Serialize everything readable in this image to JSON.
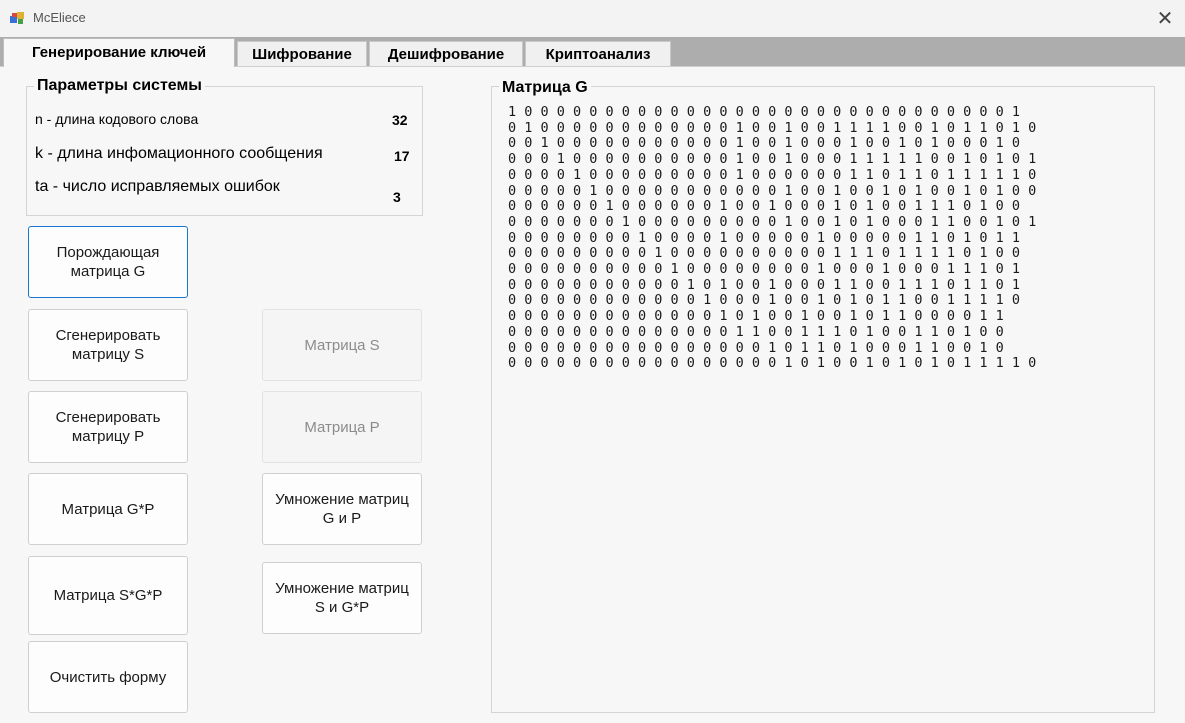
{
  "window": {
    "title": "McEliece",
    "close_glyph": "✕"
  },
  "tabs": [
    {
      "label": "Генерирование ключей",
      "active": true
    },
    {
      "label": "Шифрование",
      "active": false
    },
    {
      "label": "Дешифрование",
      "active": false
    },
    {
      "label": "Криптоанализ",
      "active": false
    }
  ],
  "params": {
    "title": "Параметры системы",
    "n_label": "n - длина кодового слова",
    "n_value": "32",
    "k_label": "k - длина инфомационного сообщения",
    "k_value": "17",
    "t_label": "ta - число исправляемых ошибок",
    "t_value": "3"
  },
  "buttons": {
    "generator_g": "Порождающая матрица G",
    "generate_s": "Сгенерировать матрицу S",
    "generate_p": "Сгенерировать матрицу P",
    "matrix_gp": "Матрица G*P",
    "matrix_sgp": "Матрица S*G*P",
    "clear_form": "Очистить форму",
    "matrix_s": "Матрица S",
    "matrix_p": "Матрица P",
    "multiply_gp": "Умножение матриц G и P",
    "multiply_sgp": "Умножение матриц S и G*P"
  },
  "matrix_g": {
    "title": "Матрица G",
    "rows": [
      "1 0 0 0 0 0 0 0 0 0 0 0 0 0 0 0 0 0 0 0 0 0 0 0 0 0 0 0 0 0 0 1",
      "0 1 0 0 0 0 0 0 0 0 0 0 0 0 1 0 0 1 0 0 1 1 1 1 0 0 1 0 1 1 0 1 0",
      "0 0 1 0 0 0 0 0 0 0 0 0 0 0 1 0 0 1 0 0 0 1 0 0 1 0 1 0 0 0 1 0",
      "0 0 0 1 0 0 0 0 0 0 0 0 0 0 1 0 0 1 0 0 0 1 1 1 1 1 0 0 1 0 1 0 1",
      "0 0 0 0 1 0 0 0 0 0 0 0 0 0 1 0 0 0 0 0 0 1 1 0 1 1 0 1 1 1 1 1 0",
      "0 0 0 0 0 1 0 0 0 0 0 0 0 0 0 0 0 1 0 0 1 0 0 1 0 1 0 0 1 0 1 0 0",
      "0 0 0 0 0 0 1 0 0 0 0 0 0 1 0 0 1 0 0 0 1 0 1 0 0 1 1 1 0 1 0 0",
      "0 0 0 0 0 0 0 1 0 0 0 0 0 0 0 0 0 1 0 0 1 0 1 0 0 0 1 1 0 0 1 0 1",
      "0 0 0 0 0 0 0 0 1 0 0 0 0 1 0 0 0 0 0 1 0 0 0 0 0 1 1 0 1 0 1 1",
      "0 0 0 0 0 0 0 0 0 1 0 0 0 0 0 0 0 0 0 0 1 1 1 0 1 1 1 1 0 1 0 0",
      "0 0 0 0 0 0 0 0 0 0 1 0 0 0 0 0 0 0 0 1 0 0 0 1 0 0 0 1 1 1 0 1",
      "0 0 0 0 0 0 0 0 0 0 0 1 0 1 0 0 1 0 0 0 1 1 0 0 1 1 1 0 1 1 0 1",
      "0 0 0 0 0 0 0 0 0 0 0 0 1 0 0 0 1 0 0 1 0 1 0 1 1 0 0 1 1 1 1 0",
      "0 0 0 0 0 0 0 0 0 0 0 0 0 1 0 1 0 0 1 0 0 1 0 1 1 0 0 0 0 1 1",
      "0 0 0 0 0 0 0 0 0 0 0 0 0 0 1 1 0 0 1 1 1 0 1 0 0 1 1 0 1 0 0",
      "0 0 0 0 0 0 0 0 0 0 0 0 0 0 0 0 1 0 1 1 0 1 0 0 0 1 1 0 0 1 0",
      "0 0 0 0 0 0 0 0 0 0 0 0 0 0 0 0 0 1 0 1 0 0 1 0 1 0 1 0 1 1 1 1 0"
    ]
  }
}
